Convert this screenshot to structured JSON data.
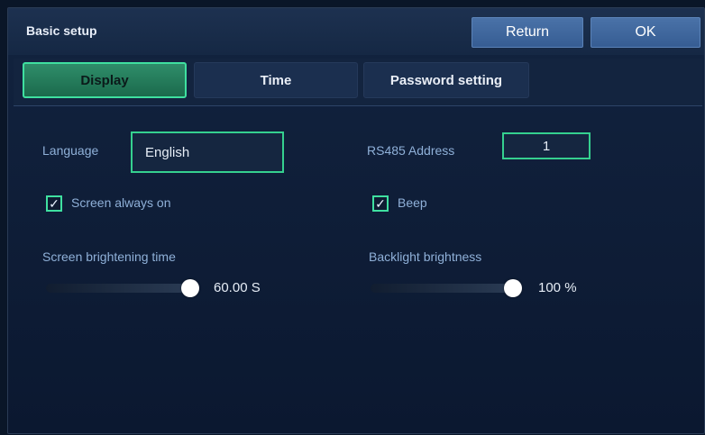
{
  "header": {
    "title": "Basic setup",
    "return_label": "Return",
    "ok_label": "OK"
  },
  "tabs": [
    {
      "label": "Display",
      "active": true
    },
    {
      "label": "Time",
      "active": false
    },
    {
      "label": "Password setting",
      "active": false
    }
  ],
  "display": {
    "language_label": "Language",
    "language_value": "English",
    "rs485_label": "RS485 Address",
    "rs485_value": "1",
    "screen_always_on": {
      "label": "Screen always on",
      "checked": true,
      "mark": "✓"
    },
    "beep": {
      "label": "Beep",
      "checked": true,
      "mark": "✓"
    },
    "brightening_time": {
      "label": "Screen brightening time",
      "value_text": "60.00 S",
      "level": 1.0
    },
    "backlight": {
      "label": "Backlight brightness",
      "value_text": "100 %",
      "level": 1.0
    }
  },
  "colors": {
    "accent": "#3fe0a0",
    "header_button": "#4a72a8",
    "background": "#0b1830",
    "label": "#8fb0d8"
  }
}
